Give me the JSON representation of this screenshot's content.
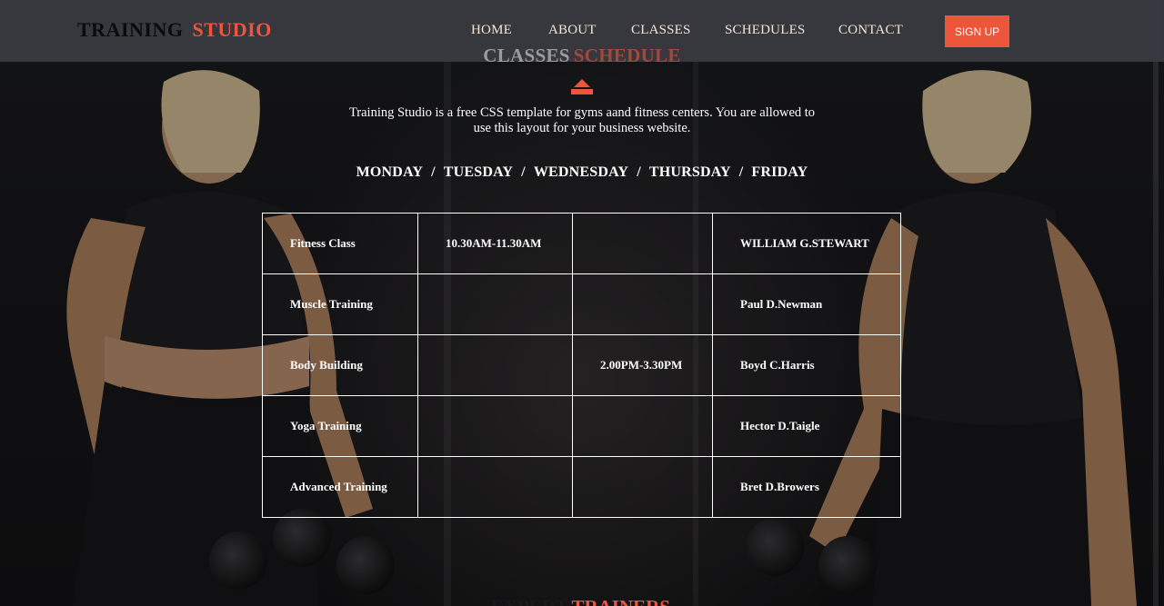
{
  "header": {
    "logo_part1": "TRAINING",
    "logo_part2": "STUDIO",
    "nav": [
      "HOME",
      "ABOUT",
      "CLASSES",
      "SCHEDULES",
      "CONTACT"
    ],
    "signup": "SIGN UP"
  },
  "section": {
    "title_part1": "CLASSES",
    "title_part2": "SCHEDULE",
    "description": "Training Studio is a free CSS template for gyms aand fitness centers. You are allowed to use this layout for your business website.",
    "days": [
      "MONDAY",
      "TUESDAY",
      "WEDNESDAY",
      "THURSDAY",
      "FRIDAY"
    ],
    "day_separator": "/"
  },
  "schedule": {
    "rows": [
      [
        "Fitness Class",
        "10.30AM-11.30AM",
        "",
        "WILLIAM G.STEWART"
      ],
      [
        "Muscle Training",
        "",
        "",
        "Paul D.Newman"
      ],
      [
        "Body Building",
        "",
        "2.00PM-3.30PM",
        "Boyd C.Harris"
      ],
      [
        "Yoga Training",
        "",
        "",
        "Hector D.Taigle"
      ],
      [
        "Advanced Training",
        "",
        "",
        "Bret D.Browers"
      ]
    ]
  },
  "next_section": {
    "title_part1": "EXPERT",
    "title_part2": "TRAINERS"
  },
  "colors": {
    "accent": "#ed563b",
    "header_bg": "#3a3a42",
    "nav_text": "#f2e6d8"
  },
  "icons": [
    "dumbbell-icon"
  ]
}
